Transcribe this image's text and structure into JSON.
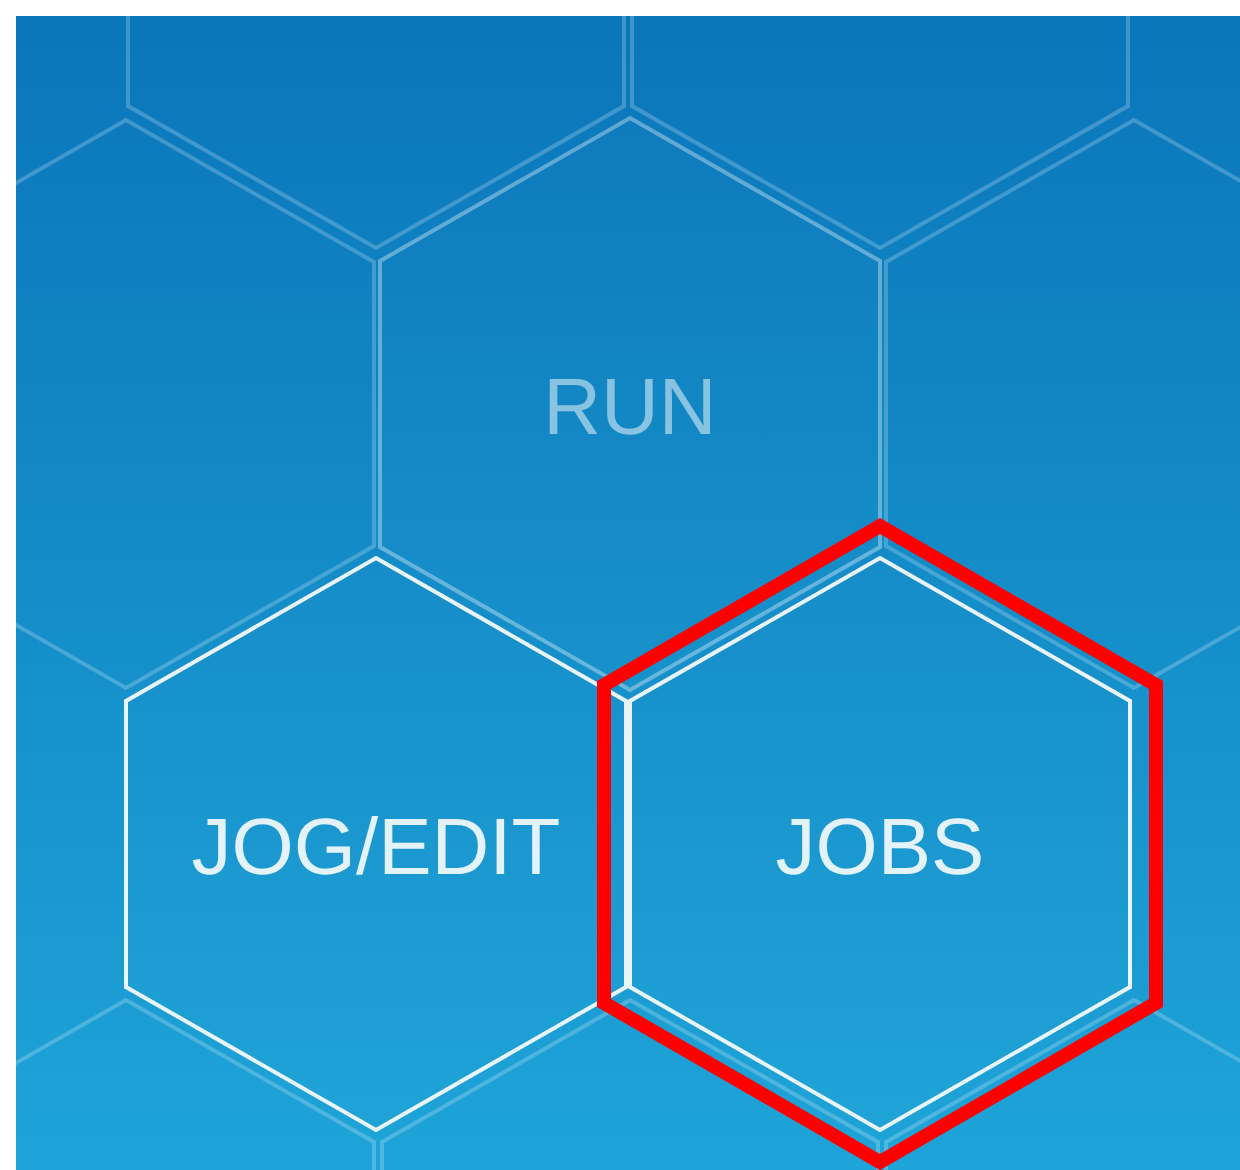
{
  "menu": [
    {
      "label": "RUN",
      "disabled": true,
      "selected": false
    },
    {
      "label": "JOG/EDIT",
      "disabled": false,
      "selected": false
    },
    {
      "label": "JOBS",
      "disabled": false,
      "selected": true
    }
  ]
}
